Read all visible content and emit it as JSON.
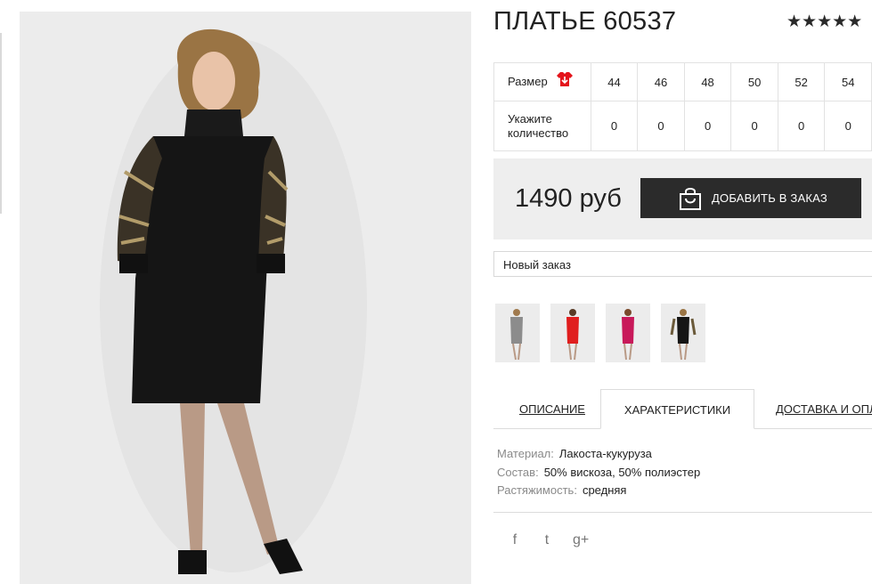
{
  "product": {
    "title": "ПЛАТЬЕ 60537",
    "rating_stars": "★★★★★"
  },
  "size_table": {
    "size_label": "Размер",
    "quantity_label": "Укажите количество",
    "sizes": [
      "44",
      "46",
      "48",
      "50",
      "52",
      "54"
    ],
    "quantities": [
      "0",
      "0",
      "0",
      "0",
      "0",
      "0"
    ]
  },
  "buy": {
    "price": "1490 руб",
    "add_button": "ДОБАВИТЬ В ЗАКАЗ"
  },
  "order_select": {
    "selected": "Новый заказ"
  },
  "tabs": {
    "description": "ОПИСАНИЕ",
    "characteristics": "ХАРАКТЕРИСТИКИ",
    "delivery": "ДОСТАВКА И ОПЛАТА"
  },
  "specs": [
    {
      "key": "Материал:",
      "value": "Лакоста-кукуруза"
    },
    {
      "key": "Состав:",
      "value": "50% вискоза, 50% полиэстер"
    },
    {
      "key": "Растяжимость:",
      "value": "средняя"
    }
  ],
  "social": {
    "facebook": "f",
    "twitter": "t",
    "googleplus": "g+"
  },
  "colors": {
    "accent_dark": "#2b2b2b",
    "buybox_bg": "#eeeeee",
    "size_icon_red": "#e4141b"
  },
  "thumbnail_colors": [
    "grey",
    "red",
    "magenta",
    "black"
  ]
}
